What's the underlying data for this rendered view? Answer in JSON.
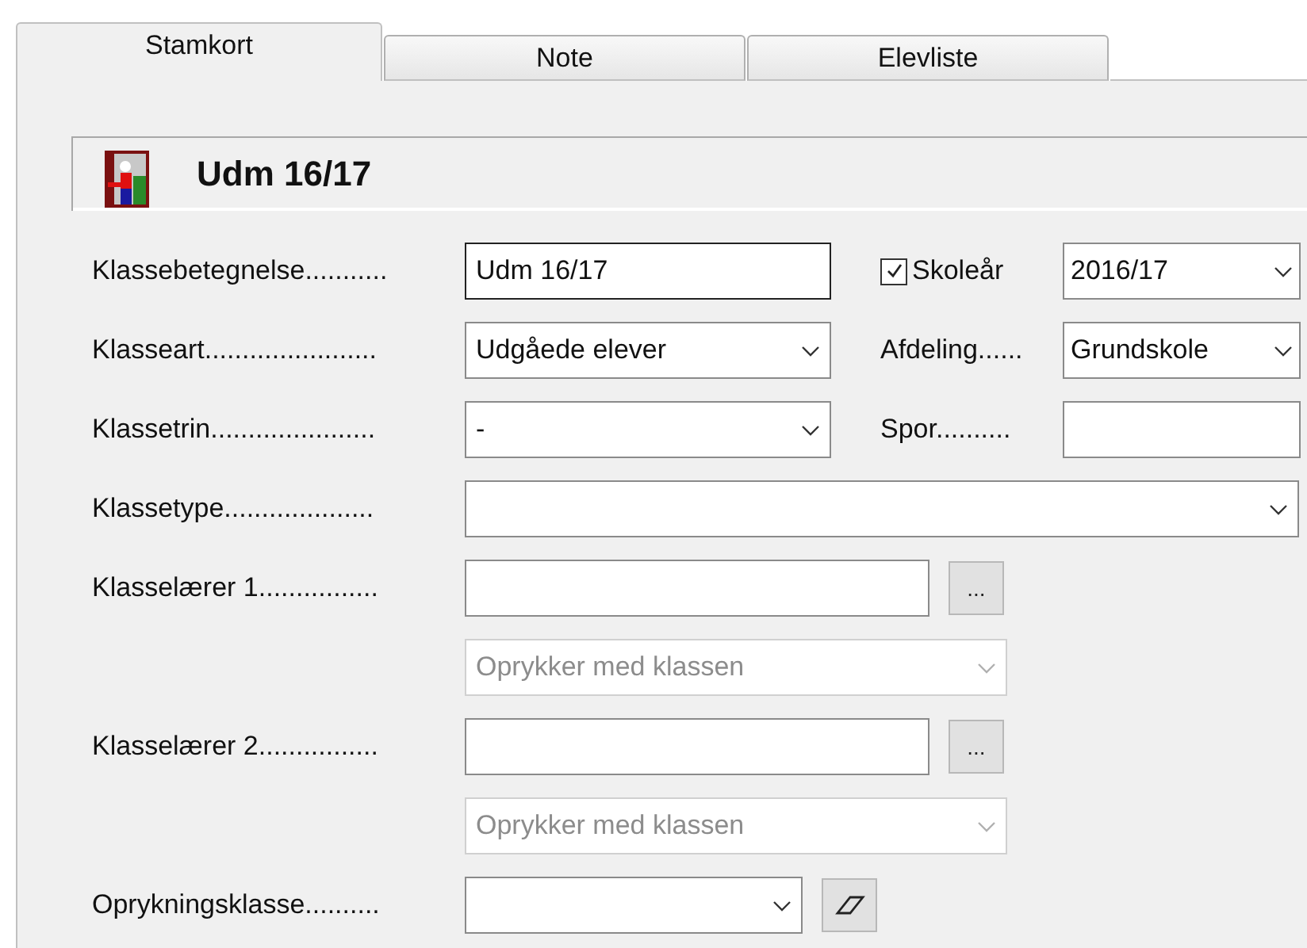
{
  "tabs": [
    {
      "label": "Stamkort",
      "selected": true
    },
    {
      "label": "Note",
      "selected": false
    },
    {
      "label": "Elevliste",
      "selected": false
    }
  ],
  "header": {
    "title": "Udm 16/17"
  },
  "rows": [
    {
      "label": "Klassebetegnelse...........",
      "control": {
        "kind": "text",
        "value": "Udm 16/17",
        "focused": true
      },
      "side": {
        "label": "Skoleår",
        "checked": true,
        "control": {
          "kind": "combo",
          "value": "2016/17",
          "disabled": false
        }
      }
    },
    {
      "label": "Klasseart.......................",
      "control": {
        "kind": "combo",
        "value": "Udgåede elever",
        "disabled": false
      },
      "side": {
        "label": "Afdeling......",
        "control": {
          "kind": "combo",
          "value": "Grundskole",
          "disabled": false
        }
      }
    },
    {
      "label": "Klassetrin......................",
      "control": {
        "kind": "combo",
        "value": "-",
        "disabled": false
      },
      "side": {
        "label": "Spor..........",
        "control": {
          "kind": "text",
          "focused": false
        }
      }
    },
    {
      "label": "Klassetype....................",
      "control": {
        "kind": "combo_wide",
        "disabled": false
      }
    },
    {
      "label": "Klasselærer 1................",
      "control": {
        "kind": "text_browse",
        "button": "...",
        "focused": false
      }
    },
    {
      "control": {
        "kind": "combo",
        "value": "Oprykker med klassen",
        "disabled": true
      }
    },
    {
      "label": "Klasselærer 2................",
      "control": {
        "kind": "text_browse",
        "button": "...",
        "focused": false
      }
    },
    {
      "control": {
        "kind": "combo",
        "value": "Oprykker med klassen",
        "disabled": true
      }
    },
    {
      "label": "Oprykningsklasse..........",
      "control": {
        "kind": "combo_clear",
        "disabled": false
      }
    }
  ]
}
